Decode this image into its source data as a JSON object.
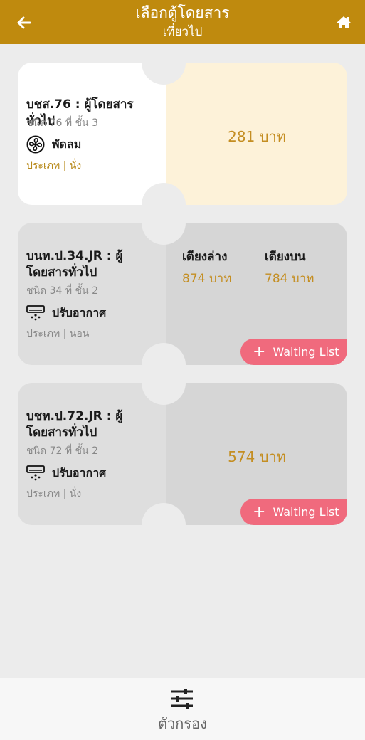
{
  "header": {
    "title": "เลือกตู้โดยสาร",
    "subtitle": "เที่ยวไป",
    "back_icon": "arrow-left-icon",
    "home_icon": "home-icon"
  },
  "colors": {
    "header": "#bf8a0e",
    "price": "#c48e22",
    "waiting": "#f06a7d",
    "highlight": "#fdf2d9"
  },
  "cars": [
    {
      "name": "บชส.76 : ผู้โดยสารทั่วไป",
      "info": "ชนิด 76 ที่ ชั้น 3",
      "type_icon": "fan-icon",
      "type_label": "พัดลม",
      "class_label": "ประเภท | นั่ง",
      "price": "281 บาท"
    },
    {
      "name": "บนท.ป.34.JR : ผู้โดยสารทั่วไป",
      "info": "ชนิด 34 ที่ ชั้น 2",
      "type_icon": "air-conditioner-icon",
      "type_label": "ปรับอากาศ",
      "class_label": "ประเภท | นอน",
      "lower_label": "เตียงล่าง",
      "lower_price": "874 บาท",
      "upper_label": "เตียงบน",
      "upper_price": "784 บาท",
      "waiting_label": "Waiting List"
    },
    {
      "name": "บชท.ป.72.JR : ผู้โดยสารทั่วไป",
      "info": "ชนิด 72 ที่ ชั้น 2",
      "type_icon": "air-conditioner-icon",
      "type_label": "ปรับอากาศ",
      "class_label": "ประเภท | นั่ง",
      "price": "574 บาท",
      "waiting_label": "Waiting List"
    }
  ],
  "bottom": {
    "filter_icon": "sliders-icon",
    "filter_label": "ตัวกรอง"
  }
}
